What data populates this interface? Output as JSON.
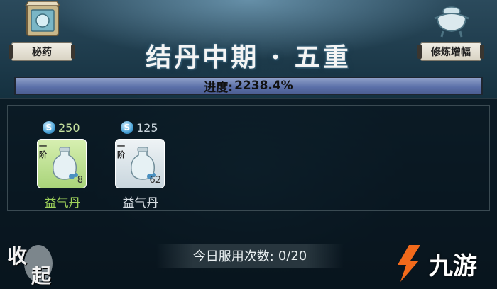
{
  "header": {
    "secret_medicine_label": "秘药",
    "cultivation_boost_label": "修炼增幅",
    "realm_title": "结丹中期 · 五重"
  },
  "progress": {
    "label": "进度:",
    "value_text": "2238.4%",
    "fill_fraction": 1.0
  },
  "items": [
    {
      "cost": "250",
      "tier": "一阶",
      "count": "8",
      "name": "益气丹",
      "color": "#9fd35a"
    },
    {
      "cost": "125",
      "tier": "一阶",
      "count": "62",
      "name": "益气丹",
      "color": "#d6dde2"
    }
  ],
  "collapse": {
    "char1": "收",
    "char2": "起"
  },
  "usage": {
    "label": "今日服用次数:",
    "value": "0/20"
  },
  "watermark": {
    "text": "九游"
  },
  "colors": {
    "accent_orange": "#f26a1b",
    "progress_fill": "#5a6fa8"
  }
}
